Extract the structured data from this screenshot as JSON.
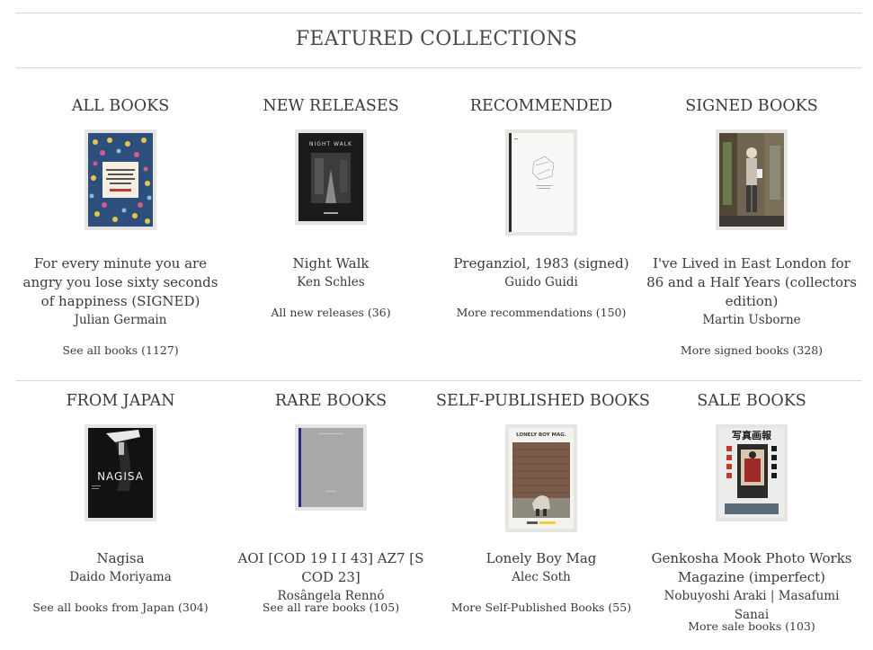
{
  "header": {
    "title": "FEATURED COLLECTIONS"
  },
  "collections": [
    {
      "category": "ALL BOOKS",
      "title": "For every minute you are angry you lose sixty seconds of happiness (SIGNED)",
      "author": "Julian Germain",
      "link": "See all books (1127)",
      "cover_icon": "floral-pattern-book-cover-icon"
    },
    {
      "category": "NEW RELEASES",
      "title": "Night Walk",
      "author": "Ken Schles",
      "link": "All new releases (36)",
      "cover_icon": "night-walk-book-cover-icon",
      "cover_text": "NIGHT WALK"
    },
    {
      "category": "RECOMMENDED",
      "title": "Preganziol, 1983 (signed)",
      "author": "Guido Guidi",
      "link": "More recommendations (150)",
      "cover_icon": "white-book-cover-icon"
    },
    {
      "category": "SIGNED BOOKS",
      "title": "I've Lived in East London for 86 and a Half Years (collectors edition)",
      "author": "Martin Usborne",
      "link": "More signed books (328)",
      "cover_icon": "street-portrait-book-cover-icon"
    },
    {
      "category": "FROM JAPAN",
      "title": "Nagisa",
      "author": "Daido Moriyama",
      "link": "See all books from Japan (304)",
      "cover_icon": "nagisa-book-cover-icon",
      "cover_text": "NAGISA"
    },
    {
      "category": "RARE BOOKS",
      "title": "AOI [COD 19 I I 43] AZ7 [S COD 23]",
      "author": "Rosângela Rennó",
      "link": "See all rare books (105)",
      "cover_icon": "grey-book-cover-icon"
    },
    {
      "category": "SELF-PUBLISHED BOOKS",
      "title": "Lonely Boy Mag",
      "author": "Alec Soth",
      "link": "More Self-Published Books (55)",
      "cover_icon": "lonely-boy-mag-cover-icon",
      "cover_text": "LONELY BOY MAG."
    },
    {
      "category": "SALE BOOKS",
      "title": "Genkosha Mook Photo Works Magazine (imperfect)",
      "author": "Nobuyoshi Araki | Masafumi Sanai",
      "link": "More sale books (103)",
      "cover_icon": "genkosha-magazine-cover-icon",
      "cover_text": "写真画報"
    }
  ],
  "colors": {
    "text": "#3a3a3a",
    "rule": "#d6d6d6",
    "cover_frame": "#e6e5e1"
  }
}
